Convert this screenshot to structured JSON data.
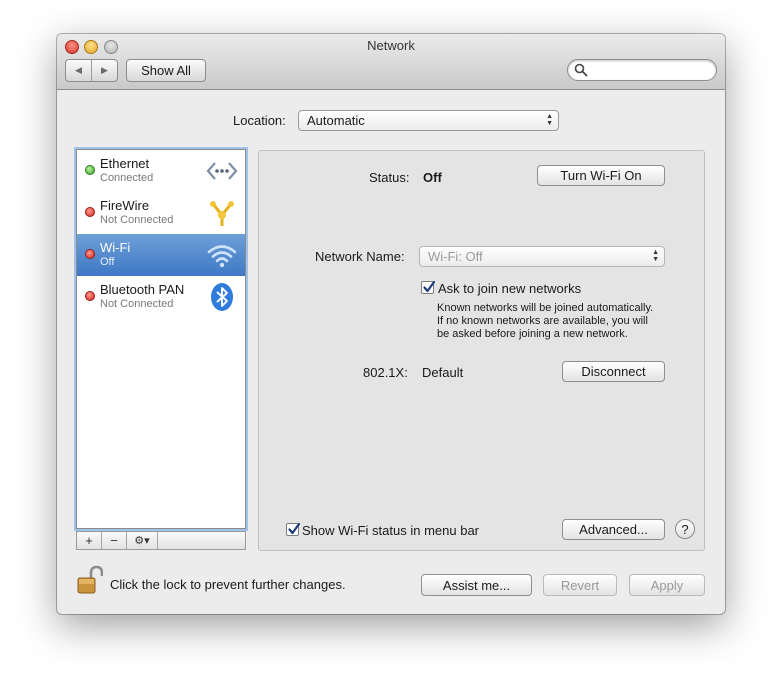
{
  "window": {
    "title": "Network"
  },
  "toolbar": {
    "back_glyph": "◀",
    "forward_glyph": "▶",
    "show_all": "Show All",
    "search_placeholder": ""
  },
  "location": {
    "label": "Location:",
    "value": "Automatic"
  },
  "services": [
    {
      "name": "Ethernet",
      "status": "Connected",
      "dot": "green",
      "icon": "ethernet-icon"
    },
    {
      "name": "FireWire",
      "status": "Not Connected",
      "dot": "red",
      "icon": "firewire-icon"
    },
    {
      "name": "Wi-Fi",
      "status": "Off",
      "dot": "red",
      "icon": "wifi-icon",
      "selected": true
    },
    {
      "name": "Bluetooth PAN",
      "status": "Not Connected",
      "dot": "red",
      "icon": "bluetooth-icon"
    }
  ],
  "sidebar_tools": {
    "add": "+",
    "remove": "−",
    "gear": "⚙▾"
  },
  "detail": {
    "status_label": "Status:",
    "status_value": "Off",
    "turn_on_button": "Turn Wi-Fi On",
    "network_name_label": "Network Name:",
    "network_name_value": "Wi-Fi: Off",
    "ask_join_label": "Ask to join new networks",
    "ask_join_checked": true,
    "ask_join_note_1": "Known networks will be joined automatically.",
    "ask_join_note_2": "If no known networks are available, you will",
    "ask_join_note_3": "be asked before joining a new network.",
    "dot1x_label": "802.1X:",
    "dot1x_value": "Default",
    "disconnect_button": "Disconnect",
    "show_status_label": "Show Wi-Fi status in menu bar",
    "show_status_checked": true,
    "advanced_button": "Advanced...",
    "help_glyph": "?"
  },
  "footer": {
    "lock_text": "Click the lock to prevent further changes.",
    "assist_button": "Assist me...",
    "revert_button": "Revert",
    "apply_button": "Apply"
  },
  "colors": {
    "selection": "#3e78c5",
    "connected": "#3aa22a",
    "disconnected": "#d3261b",
    "window_bg": "#ececec"
  }
}
